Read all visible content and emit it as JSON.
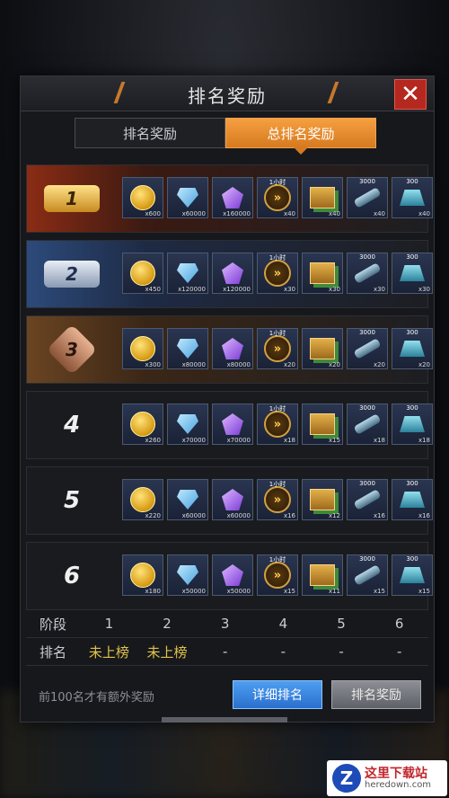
{
  "dialog": {
    "title": "排名奖励",
    "close_symbol": "✕",
    "tabs": [
      {
        "label": "排名奖励",
        "active": false
      },
      {
        "label": "总排名奖励",
        "active": true
      }
    ]
  },
  "reward_rows": [
    {
      "rank": "1",
      "badge": "gold",
      "items": [
        {
          "icon": "gold-coin",
          "qty": "x600"
        },
        {
          "icon": "blue-diamond",
          "qty": "x60000"
        },
        {
          "icon": "purple-gem",
          "qty": "x160000"
        },
        {
          "icon": "speed-up",
          "top": "1小时",
          "qty": "x40"
        },
        {
          "icon": "supply-crate",
          "qty": "x40"
        },
        {
          "icon": "cannon-tube",
          "top": "3000",
          "qty": "x40"
        },
        {
          "icon": "hologram",
          "top": "300",
          "qty": "x40"
        }
      ]
    },
    {
      "rank": "2",
      "badge": "silver",
      "items": [
        {
          "icon": "gold-coin",
          "qty": "x450"
        },
        {
          "icon": "blue-diamond",
          "qty": "x120000"
        },
        {
          "icon": "purple-gem",
          "qty": "x120000"
        },
        {
          "icon": "speed-up",
          "top": "1小时",
          "qty": "x30"
        },
        {
          "icon": "supply-crate",
          "qty": "x30"
        },
        {
          "icon": "cannon-tube",
          "top": "3000",
          "qty": "x30"
        },
        {
          "icon": "hologram",
          "top": "300",
          "qty": "x30"
        }
      ]
    },
    {
      "rank": "3",
      "badge": "bronze",
      "items": [
        {
          "icon": "gold-coin",
          "qty": "x300"
        },
        {
          "icon": "blue-diamond",
          "qty": "x80000"
        },
        {
          "icon": "purple-gem",
          "qty": "x80000"
        },
        {
          "icon": "speed-up",
          "top": "1小时",
          "qty": "x20"
        },
        {
          "icon": "supply-crate",
          "qty": "x20"
        },
        {
          "icon": "cannon-tube",
          "top": "3000",
          "qty": "x20"
        },
        {
          "icon": "hologram",
          "top": "300",
          "qty": "x20"
        }
      ]
    },
    {
      "rank": "4",
      "badge": "plain",
      "items": [
        {
          "icon": "gold-coin",
          "qty": "x260"
        },
        {
          "icon": "blue-diamond",
          "qty": "x70000"
        },
        {
          "icon": "purple-gem",
          "qty": "x70000"
        },
        {
          "icon": "speed-up",
          "top": "1小时",
          "qty": "x18"
        },
        {
          "icon": "supply-crate",
          "qty": "x15"
        },
        {
          "icon": "cannon-tube",
          "top": "3000",
          "qty": "x18"
        },
        {
          "icon": "hologram",
          "top": "300",
          "qty": "x18"
        }
      ]
    },
    {
      "rank": "5",
      "badge": "plain",
      "items": [
        {
          "icon": "gold-coin",
          "qty": "x220"
        },
        {
          "icon": "blue-diamond",
          "qty": "x60000"
        },
        {
          "icon": "purple-gem",
          "qty": "x60000"
        },
        {
          "icon": "speed-up",
          "top": "1小时",
          "qty": "x16"
        },
        {
          "icon": "supply-crate",
          "qty": "x12"
        },
        {
          "icon": "cannon-tube",
          "top": "3000",
          "qty": "x16"
        },
        {
          "icon": "hologram",
          "top": "300",
          "qty": "x16"
        }
      ]
    },
    {
      "rank": "6",
      "badge": "plain",
      "items": [
        {
          "icon": "gold-coin",
          "qty": "x180"
        },
        {
          "icon": "blue-diamond",
          "qty": "x50000"
        },
        {
          "icon": "purple-gem",
          "qty": "x50000"
        },
        {
          "icon": "speed-up",
          "top": "1小时",
          "qty": "x15"
        },
        {
          "icon": "supply-crate",
          "qty": "x11"
        },
        {
          "icon": "cannon-tube",
          "top": "3000",
          "qty": "x15"
        },
        {
          "icon": "hologram",
          "top": "300",
          "qty": "x15"
        }
      ]
    }
  ],
  "stage_table": {
    "stage_label": "阶段",
    "rank_label": "排名",
    "stages": [
      "1",
      "2",
      "3",
      "4",
      "5",
      "6"
    ],
    "ranks": [
      "未上榜",
      "未上榜",
      "-",
      "-",
      "-",
      "-"
    ]
  },
  "footer": {
    "note": "前100名才有额外奖励",
    "detail_button": "详细排名",
    "reward_button": "排名奖励"
  },
  "watermark": {
    "logo_letter": "Z",
    "name": "这里下载站",
    "url": "heredown.com"
  },
  "colors": {
    "accent_orange": "#e88a2a",
    "close_red": "#b5281f",
    "button_blue": "#3a86e0",
    "highlight_yellow": "#e0c34a"
  }
}
